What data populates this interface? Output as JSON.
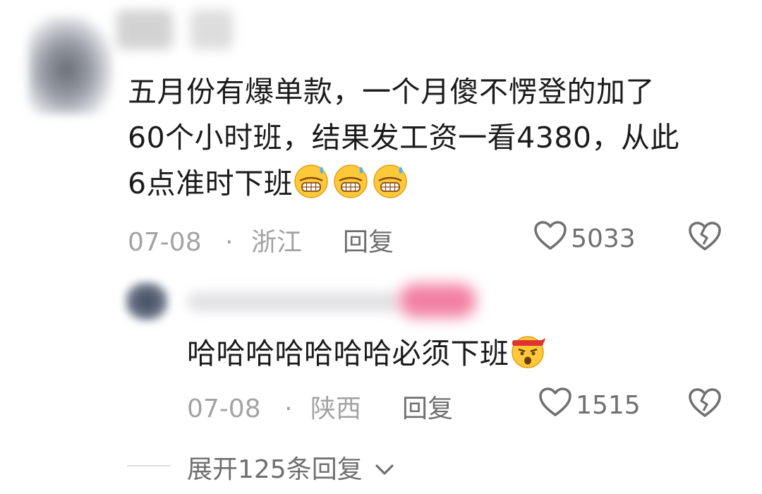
{
  "comment": {
    "text_lines": [
      "五月份有爆单款，一个月傻不愣登的加了",
      "60个小时班，结果发工资一看4380，从此",
      "6点准时下班"
    ],
    "emoji": "sweat-smile-emoji",
    "date": "07-08",
    "dot": "·",
    "location": "浙江",
    "reply_label": "回复",
    "like_count": "5033"
  },
  "reply": {
    "text": "哈哈哈哈哈哈哈必须下班",
    "emoji": "headband-shout-emoji",
    "date": "07-08",
    "dot": "·",
    "location": "陕西",
    "reply_label": "回复",
    "like_count": "1515"
  },
  "expand": {
    "label": "展开125条回复"
  },
  "colors": {
    "text": "#1b1b1b",
    "meta": "#a3a3a3",
    "icon": "#707070"
  }
}
